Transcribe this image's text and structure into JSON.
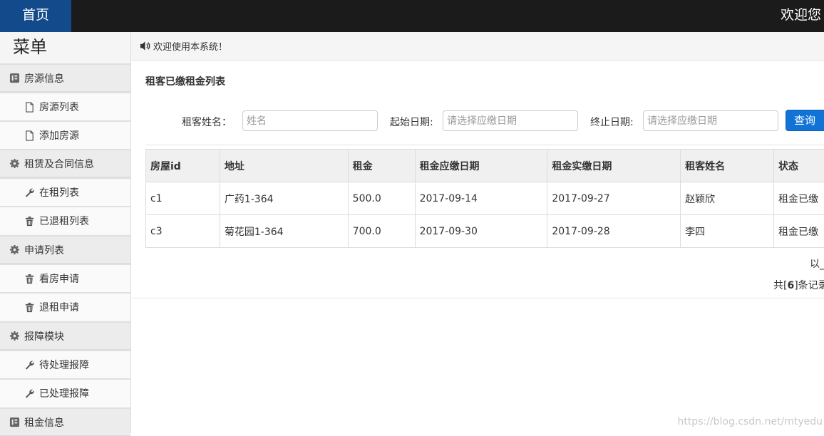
{
  "topbar": {
    "home_label": "首页",
    "welcome_text": "欢迎您"
  },
  "sidebar": {
    "title": "菜单",
    "groups": [
      {
        "label": "房源信息",
        "icon": "book-icon",
        "items": [
          {
            "label": "房源列表",
            "icon": "file-icon"
          },
          {
            "label": "添加房源",
            "icon": "file-icon"
          }
        ]
      },
      {
        "label": "租赁及合同信息",
        "icon": "gear-icon",
        "items": [
          {
            "label": "在租列表",
            "icon": "wrench-icon"
          },
          {
            "label": "已退租列表",
            "icon": "trash-icon"
          }
        ]
      },
      {
        "label": "申请列表",
        "icon": "gear-icon",
        "items": [
          {
            "label": "看房申请",
            "icon": "trash-icon"
          },
          {
            "label": "退租申请",
            "icon": "trash-icon"
          }
        ]
      },
      {
        "label": "报障模块",
        "icon": "gear-icon",
        "items": [
          {
            "label": "待处理报障",
            "icon": "wrench-icon"
          },
          {
            "label": "已处理报障",
            "icon": "wrench-icon"
          }
        ]
      },
      {
        "label": "租金信息",
        "icon": "book-icon",
        "items": []
      }
    ]
  },
  "notice": {
    "text": "欢迎使用本系统！",
    "icon": "volume-icon"
  },
  "panel": {
    "title": "租客已缴租金列表"
  },
  "search": {
    "name_label": "租客姓名：",
    "name_placeholder": "姓名",
    "start_label": "起始日期:",
    "start_placeholder": "请选择应缴日期",
    "end_label": "终止日期:",
    "end_placeholder": "请选择应缴日期",
    "button_label": "查询"
  },
  "table": {
    "headers": [
      "房屋id",
      "地址",
      "租金",
      "租金应缴日期",
      "租金实缴日期",
      "租客姓名",
      "状态"
    ],
    "rows": [
      [
        "c1",
        "广药1-364",
        "500.0",
        "2017-09-14",
        "2017-09-27",
        "赵颖欣",
        "租金已缴"
      ],
      [
        "c3",
        "菊花园1-364",
        "700.0",
        "2017-09-30",
        "2017-09-28",
        "李四",
        "租金已缴"
      ]
    ]
  },
  "footer": {
    "partial_text": "以_",
    "total_prefix": "共[",
    "total_count": "6",
    "total_suffix": "]条记录"
  },
  "watermark": "https://blog.csdn.net/mtyedu"
}
